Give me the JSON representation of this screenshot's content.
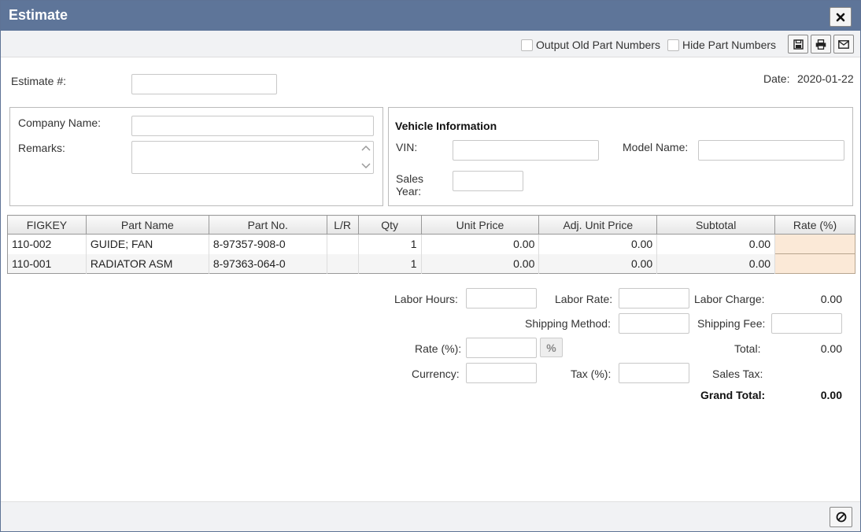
{
  "window": {
    "title": "Estimate"
  },
  "toolbar": {
    "output_old_part_numbers": "Output Old Part Numbers",
    "hide_part_numbers": "Hide Part Numbers"
  },
  "header": {
    "estimate_label": "Estimate #:",
    "estimate_value": "",
    "date_label": "Date:",
    "date_value": "2020-01-22"
  },
  "company": {
    "company_name_label": "Company Name:",
    "company_name_value": "",
    "remarks_label": "Remarks:",
    "remarks_value": ""
  },
  "vehicle": {
    "title": "Vehicle Information",
    "vin_label": "VIN:",
    "model_name_label": "Model Name:",
    "sales_year_label_1": "Sales",
    "sales_year_label_2": "Year:"
  },
  "table": {
    "columns": [
      "FIGKEY",
      "Part Name",
      "Part No.",
      "L/R",
      "Qty",
      "Unit Price",
      "Adj. Unit Price",
      "Subtotal",
      "Rate (%)"
    ],
    "rows": [
      {
        "figkey": "110-002",
        "part_name": "GUIDE; FAN",
        "part_no": "8-97357-908-0",
        "lr": "",
        "qty": "1",
        "unit_price": "0.00",
        "adj_unit_price": "0.00",
        "subtotal": "0.00",
        "rate": ""
      },
      {
        "figkey": "110-001",
        "part_name": "RADIATOR ASM",
        "part_no": "8-97363-064-0",
        "lr": "",
        "qty": "1",
        "unit_price": "0.00",
        "adj_unit_price": "0.00",
        "subtotal": "0.00",
        "rate": ""
      }
    ]
  },
  "totals": {
    "labor_hours_label": "Labor Hours:",
    "labor_rate_label": "Labor Rate:",
    "labor_charge_label": "Labor Charge:",
    "labor_charge_value": "0.00",
    "shipping_method_label": "Shipping Method:",
    "shipping_fee_label": "Shipping Fee:",
    "rate_label": "Rate (%):",
    "percent_button": "%",
    "total_label": "Total:",
    "total_value": "0.00",
    "currency_label": "Currency:",
    "tax_label": "Tax (%):",
    "sales_tax_label": "Sales Tax:",
    "sales_tax_value": "",
    "grand_total_label": "Grand Total:",
    "grand_total_value": "0.00"
  },
  "icons": {
    "close": "close-icon",
    "save": "save-icon",
    "print": "print-icon",
    "email": "email-icon",
    "cancel": "cancel-icon"
  }
}
